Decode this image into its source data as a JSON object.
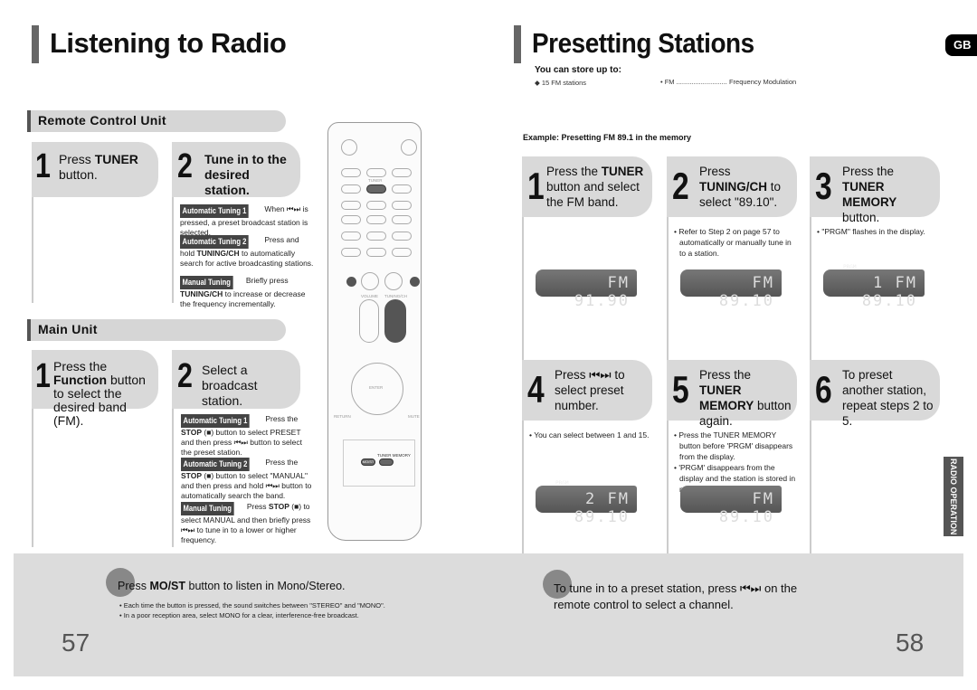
{
  "left": {
    "title": "Listening to Radio",
    "remote_section": "Remote Control Unit",
    "remote_steps": [
      {
        "number": "1",
        "pre": "Press ",
        "bold": "TUNER",
        "post": " button."
      },
      {
        "number": "2",
        "text": "Tune in to the desired station."
      }
    ],
    "remote_modes": [
      {
        "label": "Automatic Tuning 1",
        "pre": "When ",
        "icon": "prev-next-icon",
        "post": " is pressed, a preset broadcast station is selected."
      },
      {
        "label": "Automatic Tuning 2",
        "pre": "Press and hold ",
        "bold": "TUNING/CH",
        "post": " to automatically search for active broadcasting stations."
      },
      {
        "label": "Manual Tuning",
        "pre": "Briefly press ",
        "bold": "TUNING/CH",
        "post": " to increase or decrease the frequency incrementally."
      }
    ],
    "main_section": "Main Unit",
    "main_steps": [
      {
        "number": "1",
        "pre": "Press the ",
        "bold": "Function",
        "post": " button to select the desired band (FM)."
      },
      {
        "number": "2",
        "text": "Select a broadcast station."
      }
    ],
    "main_modes": [
      {
        "label": "Automatic Tuning 1",
        "pre": "Press the ",
        "bold": "STOP",
        "mid": " (■) button to select PRESET and then press ",
        "post": " button to select the preset station."
      },
      {
        "label": "Automatic Tuning 2",
        "pre": "Press the ",
        "bold": "STOP",
        "mid": " (■) button to select \"MANUAL\" and then press and hold ",
        "post": " button to automatically search the band."
      },
      {
        "label": "Manual Tuning",
        "pre": "Press ",
        "bold": "STOP",
        "mid": " (■) to select MANUAL and then briefly press ",
        "post": " to tune in to a lower or higher frequency."
      }
    ],
    "remote": {
      "tuner": "TUNER",
      "tuning_ch": "TUNING/CH",
      "volume": "VOLUME",
      "tuner_memory": "TUNER MEMORY",
      "most": "MO/ST",
      "enter": "ENTER",
      "return": "RETURN",
      "mute": "MUTE"
    },
    "tip": {
      "pre": "Press ",
      "bold": "MO/ST",
      "post": " button to listen in Mono/Stereo.",
      "bullets": [
        "Each time the button is pressed, the sound switches between \"STEREO\" and \"MONO\".",
        "In a poor reception area, select MONO for a clear, interference-free broadcast."
      ]
    },
    "page_number": "57"
  },
  "right": {
    "title": "Presetting Stations",
    "lang_tab": "GB",
    "store_heading": "You can store up to:",
    "store_item": "◆ 15 FM stations",
    "abbr": "• FM ........................... Frequency Modulation",
    "example": "Example: Presetting FM 89.1 in the memory",
    "steps": [
      {
        "number": "1",
        "pre": "Press the ",
        "bold": "TUNER",
        "post": " button and select the FM band.",
        "notes": [],
        "display": "FM  91.90"
      },
      {
        "number": "2",
        "pre": "Press ",
        "bold": "TUNING/CH",
        "post": " to select \"89.10\".",
        "notes": [
          "Refer to Step 2 on page 57 to automatically or manually tune in to a station."
        ],
        "display": "FM  89.10"
      },
      {
        "number": "3",
        "pre": "Press the ",
        "bold": "TUNER MEMORY",
        "post": " button.",
        "notes": [
          "\"PRGM\" flashes in the display."
        ],
        "display": "1 FM  89.10",
        "prgm": "PRGM"
      },
      {
        "number": "4",
        "pre": "Press ",
        "icon": true,
        "post": " to select preset number.",
        "notes": [
          "You can select between 1 and 15."
        ],
        "display": "2 FM  89.10",
        "prgm": "PRGM"
      },
      {
        "number": "5",
        "pre": "Press the ",
        "bold": "TUNER MEMORY",
        "post": " button again.",
        "notes": [
          "Press the TUNER MEMORY button before 'PRGM' disappears from the display.",
          "'PRGM' disappears from the display and the station is stored in memory."
        ],
        "display": "FM  89.10"
      },
      {
        "number": "6",
        "pre": "To preset another station, repeat steps 2 to 5.",
        "notes": []
      }
    ],
    "side_tab": "RADIO OPERATION",
    "tip": {
      "pre": "To tune in to a preset station, press ",
      "post": " on the remote control to select a channel."
    },
    "page_number": "58"
  }
}
